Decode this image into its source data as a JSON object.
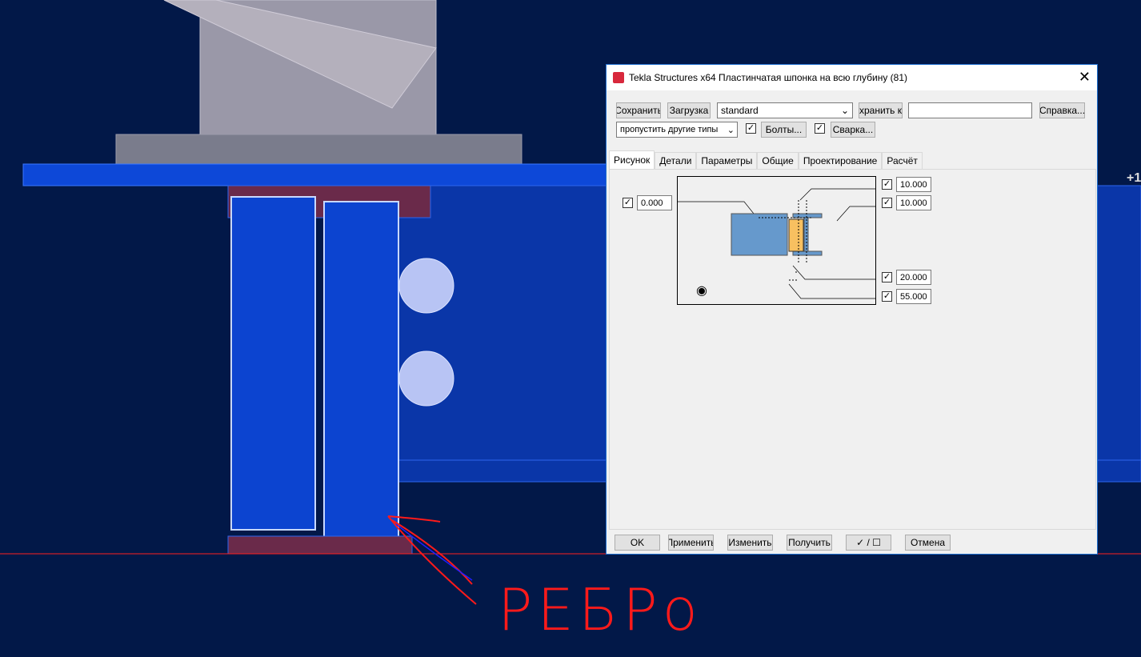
{
  "viewport": {
    "axis_label": "+1",
    "annotation": "РЕБРо",
    "colors": {
      "background": "#021848",
      "part": "#0a3fc8",
      "annotation": "#ff1a1a"
    }
  },
  "dialog": {
    "title": "Tekla Structures x64  Пластинчатая шпонка на всю глубину (81)",
    "toolbar": {
      "save": "Сохранить",
      "load": "Загрузка",
      "preset": "standard",
      "save_as": "хранить к",
      "save_as_name": "",
      "help": "Справка...",
      "filter": "пропустить другие типы",
      "bolts": "Болты...",
      "bolts_checked": true,
      "welds": "Сварка...",
      "welds_checked": true
    },
    "tabs": [
      "Рисунок",
      "Детали",
      "Параметры",
      "Общие",
      "Проектирование",
      "Расчёт"
    ],
    "active_tab": "Рисунок",
    "picture": {
      "left_value": "0.000",
      "right_values": [
        "10.000",
        "10.000",
        "20.000",
        "55.000"
      ]
    },
    "footer": {
      "ok": "OK",
      "apply": "Применить",
      "modify": "Изменить",
      "get": "Получить",
      "toggle": "✓ / ☐",
      "cancel": "Отмена"
    }
  }
}
